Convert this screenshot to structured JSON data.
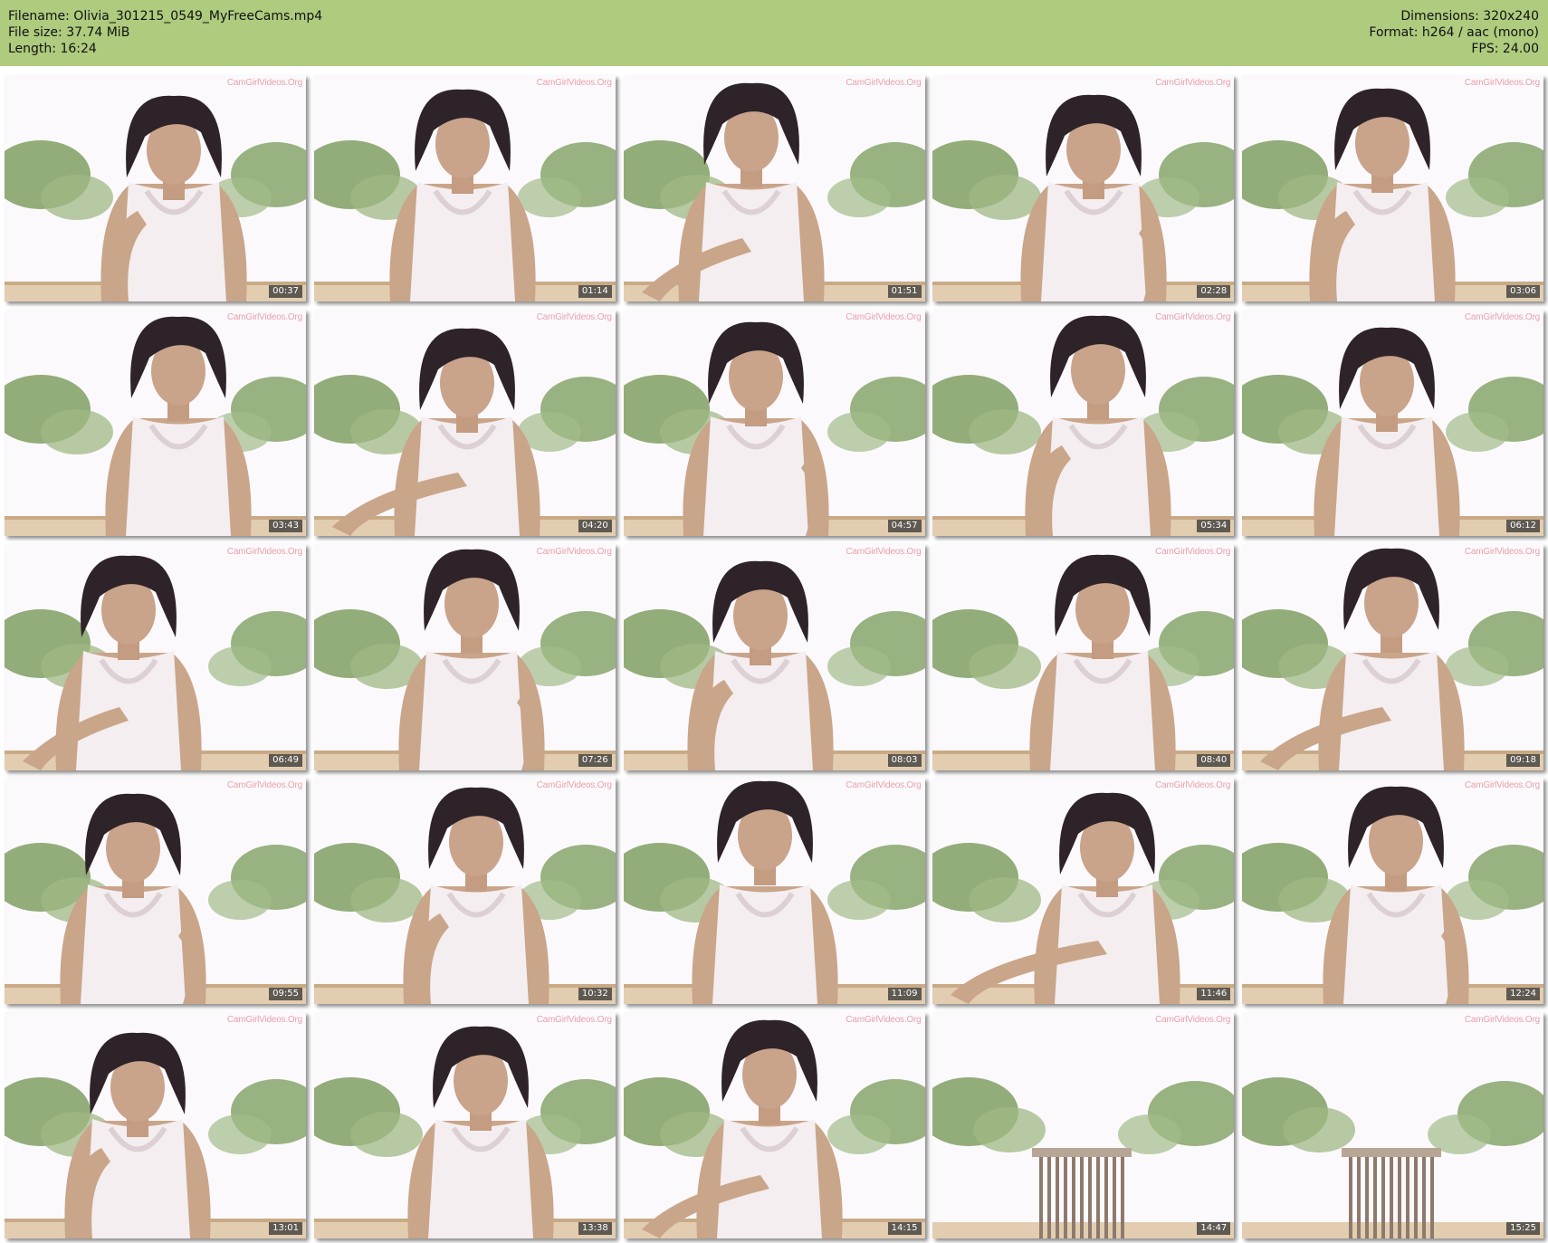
{
  "header": {
    "filename_line": "Filename: Olivia_301215_0549_MyFreeCams.mp4",
    "filesize_line": "File size: 37.74 MiB",
    "length_line": "Length: 16:24",
    "dimensions_line": "Dimensions: 320x240",
    "format_line": "Format: h264 / aac (mono)",
    "fps_line": "FPS: 24.00",
    "background_color": "#aecb7e"
  },
  "watermark": "CamGirlVideos.Org",
  "thumbnails": [
    {
      "time": "00:37",
      "person": true
    },
    {
      "time": "01:14",
      "person": true
    },
    {
      "time": "01:51",
      "person": true
    },
    {
      "time": "02:28",
      "person": true
    },
    {
      "time": "03:06",
      "person": true
    },
    {
      "time": "03:43",
      "person": true
    },
    {
      "time": "04:20",
      "person": true
    },
    {
      "time": "04:57",
      "person": true
    },
    {
      "time": "05:34",
      "person": true
    },
    {
      "time": "06:12",
      "person": true
    },
    {
      "time": "06:49",
      "person": true
    },
    {
      "time": "07:26",
      "person": true
    },
    {
      "time": "08:03",
      "person": true
    },
    {
      "time": "08:40",
      "person": true
    },
    {
      "time": "09:18",
      "person": true
    },
    {
      "time": "09:55",
      "person": true
    },
    {
      "time": "10:32",
      "person": true
    },
    {
      "time": "11:09",
      "person": true
    },
    {
      "time": "11:46",
      "person": true
    },
    {
      "time": "12:24",
      "person": true
    },
    {
      "time": "13:01",
      "person": true
    },
    {
      "time": "13:38",
      "person": true
    },
    {
      "time": "14:15",
      "person": true
    },
    {
      "time": "14:47",
      "person": false
    },
    {
      "time": "15:25",
      "person": false
    }
  ]
}
